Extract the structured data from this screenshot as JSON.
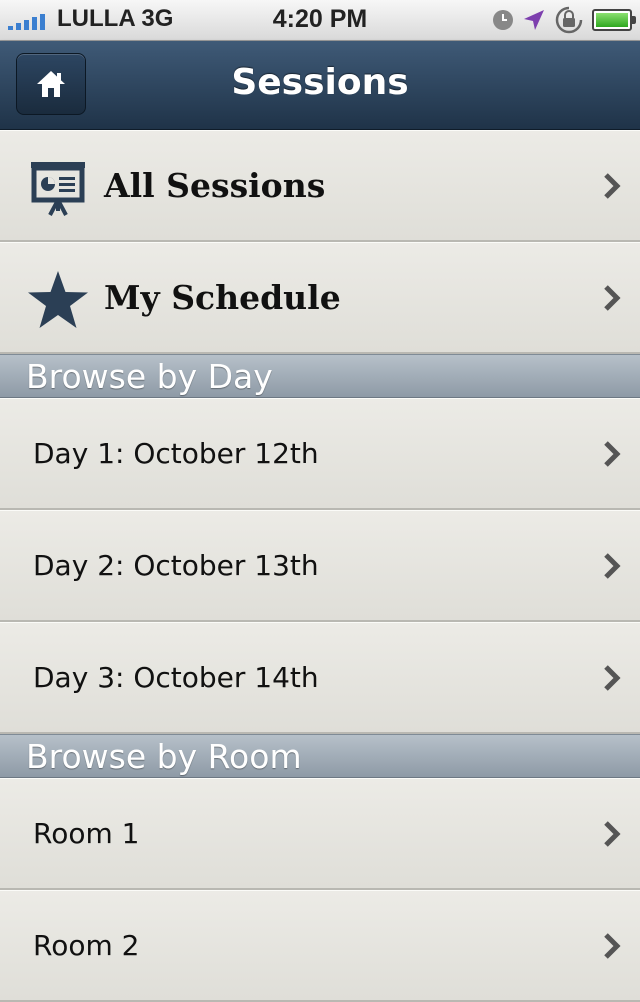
{
  "status_bar": {
    "carrier": "LULLA 3G",
    "time": "4:20 PM",
    "signal_bars": 5,
    "battery_level": 0.9
  },
  "nav": {
    "title": "Sessions",
    "home_icon": "home-icon"
  },
  "top_items": [
    {
      "label": "All Sessions",
      "icon": "presentation-board-icon"
    },
    {
      "label": "My Schedule",
      "icon": "star-icon"
    }
  ],
  "sections": [
    {
      "title": "Browse by Day",
      "items": [
        {
          "label": "Day 1: October 12th"
        },
        {
          "label": "Day 2: October 13th"
        },
        {
          "label": "Day 3: October 14th"
        }
      ]
    },
    {
      "title": "Browse by Room",
      "items": [
        {
          "label": "Room 1"
        },
        {
          "label": "Room 2"
        }
      ]
    }
  ],
  "colors": {
    "navbar": "#2b4360",
    "section_header": "#9aa6b1",
    "icon": "#2b3f55"
  }
}
